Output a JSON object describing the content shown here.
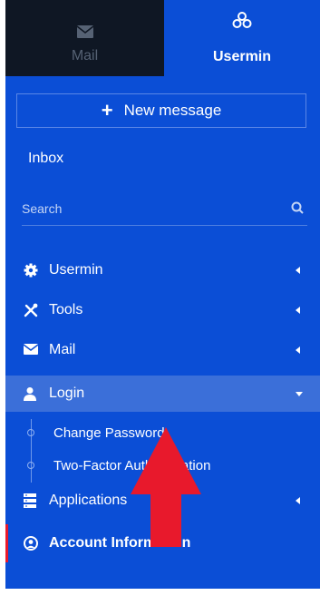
{
  "tabs": {
    "mail": {
      "label": "Mail",
      "icon": "envelope-icon"
    },
    "usermin": {
      "label": "Usermin",
      "icon": "usermin-logo-icon"
    }
  },
  "new_message": {
    "label": "New message",
    "icon": "plus-icon"
  },
  "inbox": {
    "label": "Inbox"
  },
  "search": {
    "placeholder": "Search",
    "icon": "search-icon"
  },
  "nav": {
    "usermin": {
      "label": "Usermin",
      "icon": "gear-icon"
    },
    "tools": {
      "label": "Tools",
      "icon": "tools-icon"
    },
    "mail": {
      "label": "Mail",
      "icon": "envelope-icon"
    },
    "login": {
      "label": "Login",
      "icon": "user-icon"
    },
    "login_items": [
      "Change Password",
      "Two-Factor Authentication"
    ],
    "applications": {
      "label": "Applications",
      "icon": "server-icon"
    },
    "account_information": {
      "label": "Account Information",
      "icon": "user-circle-icon"
    }
  },
  "colors": {
    "panel_blue": "#0b4ed6",
    "active_row": "#3b6fd9",
    "mail_tab_bg": "#0f1724",
    "annotation_arrow": "#e8192c"
  }
}
